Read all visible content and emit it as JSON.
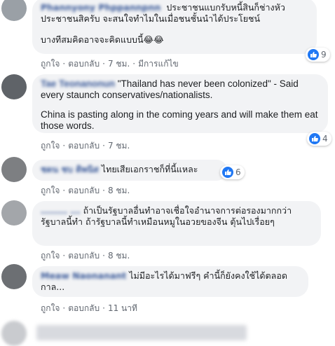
{
  "comments": [
    {
      "author": "Phannyony Phppannpnn",
      "paragraphs": [
        "ประชาชนแบกรับหนี้สินก็ช่างหัวประชาชนสิครับ จะสนใจทำไมในเมื่อชนชั้นนำได้ประโยชน์",
        "บางทีสมคิดอาจจะคิดแบบนี้😂😂"
      ],
      "actions": {
        "like": "ถูกใจ",
        "reply": "ตอบกลับ",
        "time": "7 ชม.",
        "edited": "มีการแก้ไข"
      },
      "reaction_count": "9"
    },
    {
      "author": "Tae Teonanonun",
      "paragraphs": [
        "\"Thailand has never been colonized\" - Said every staunch conservatives/nationalists.",
        "China is pasting along in the coming years and will make them eat those words."
      ],
      "actions": {
        "like": "ถูกใจ",
        "reply": "ตอบกลับ",
        "time": "7 ชม."
      },
      "reaction_count": "4"
    },
    {
      "author": "ชดน ชบ ดิพนิส",
      "paragraphs": [
        "ไทยเสียเอกราชก็ที่นี้แหละ"
      ],
      "actions": {
        "like": "ถูกใจ",
        "reply": "ตอบกลับ",
        "time": "8 ชม."
      },
      "reaction_count": "6"
    },
    {
      "author": "........ ...",
      "paragraphs": [
        "ถ้าเป็นรัฐบาลอื่นทำอาจเชื่อใจอำนาจการต่อรองมากกว่ารัฐบาลนี้ทำ ถ้ารัฐบาลนี้ทำเหมือนหมูในอวยของจีน ตุ้นไปเรื่อยๆ"
      ],
      "actions": {
        "like": "ถูกใจ",
        "reply": "ตอบกลับ",
        "time": "8 ชม."
      }
    },
    {
      "author": "Meaw Naonanant",
      "paragraphs": [
        "ไม่มีอะไรได้มาฟรีๆ คำนี้ก็ยังคงใช้ได้ตลอดกาล..."
      ],
      "actions": {
        "like": "ถูกใจ",
        "reply": "ตอบกลับ",
        "time": "11 นาที"
      }
    }
  ],
  "colors": {
    "bubble": "#f2f3f5",
    "link": "#385898",
    "like": "#2078f4",
    "meta": "#616770"
  },
  "icons": {
    "reaction": "like-icon",
    "reaction_alt": "haha-icon"
  }
}
